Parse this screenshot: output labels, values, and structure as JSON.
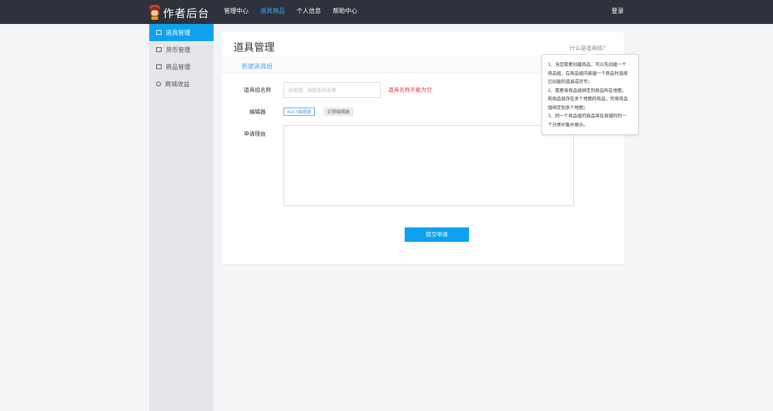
{
  "header": {
    "logo_text": "作者后台",
    "nav": [
      {
        "label": "管理中心"
      },
      {
        "label": "道具商品"
      },
      {
        "label": "个人信息"
      },
      {
        "label": "帮助中心"
      }
    ],
    "active_nav": "道具商品",
    "login_label": "登录"
  },
  "sidebar": {
    "items": [
      {
        "label": "道具管理",
        "icon": "grid-icon"
      },
      {
        "label": "货币管理",
        "icon": "card-icon"
      },
      {
        "label": "商品管理",
        "icon": "document-icon"
      },
      {
        "label": "商城收益",
        "icon": "coin-icon"
      }
    ]
  },
  "main": {
    "title": "道具管理",
    "help_link": "什么是道具组？",
    "sub_tab": "新建道具组",
    "form": {
      "name_label": "道具组名称",
      "name_placeholder": "如地图、地图系列名等",
      "name_error": "道具名称不能为空",
      "editor_label": "编辑器",
      "editor_options": [
        "war3编辑器",
        "幻想编辑器"
      ],
      "selected_editor": "war3编辑器",
      "reason_label": "申请理由",
      "reason_value": "",
      "submit_label": "提交申请"
    }
  },
  "tooltip": {
    "lines": [
      "1、当您需要创建商品，可以先创建一个",
      "商品组，在商品组内新建一个商品时选择",
      "已创建的道具或货币；",
      "2、需要将商品组绑定到商品所在地图，",
      "若商品组存在多个地图的商品，可将商品",
      "组绑定到多个地图；",
      "3、同一个商品组的商品将在商城的同一",
      "个分类中集中展示。"
    ]
  },
  "colors": {
    "topbar": "#2d323d",
    "accent": "#0ea1ef",
    "link": "#3fa9f5",
    "error": "#e8363b",
    "sidebar": "#e4e6e9"
  }
}
